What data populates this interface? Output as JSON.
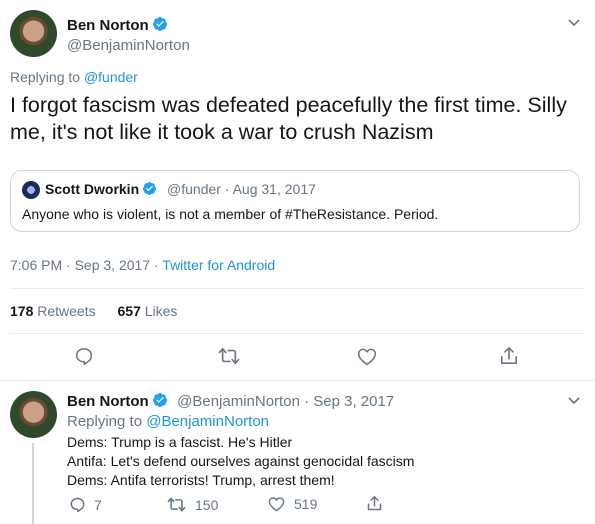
{
  "main_tweet": {
    "author_name": "Ben Norton",
    "author_handle": "@BenjaminNorton",
    "replying_prefix": "Replying to",
    "replying_to": "@funder",
    "text_line1": "I forgot fascism was defeated peacefully the first time. Silly",
    "text_line2": "me, it's not like it took a war to crush Nazism",
    "quoted": {
      "author_name": "Scott Dworkin",
      "meta": "@funder · Aug 31, 2017",
      "text": "Anyone who is violent, is not a member of #TheResistance. Period."
    },
    "timestamp": "7:06 PM · Sep 3, 2017",
    "source_sep": "·",
    "source": "Twitter for Android",
    "retweets_count": "178",
    "retweets_label": "Retweets",
    "likes_count": "657",
    "likes_label": "Likes"
  },
  "reply_tweet": {
    "author_name": "Ben Norton",
    "meta": "@BenjaminNorton · Sep 3, 2017",
    "replying_prefix": "Replying to",
    "replying_to": "@BenjaminNorton",
    "line1": "Dems: Trump is a fascist. He's Hitler",
    "line2": "Antifa: Let's defend ourselves against genocidal fascism",
    "line3": "Dems: Antifa terrorists! Trump, arrest them!",
    "reply_count": "7",
    "retweet_count": "150",
    "like_count": "519"
  },
  "colors": {
    "link": "#1b95e0",
    "muted": "#657786",
    "text": "#14171a",
    "divider": "#e6ecf0"
  }
}
